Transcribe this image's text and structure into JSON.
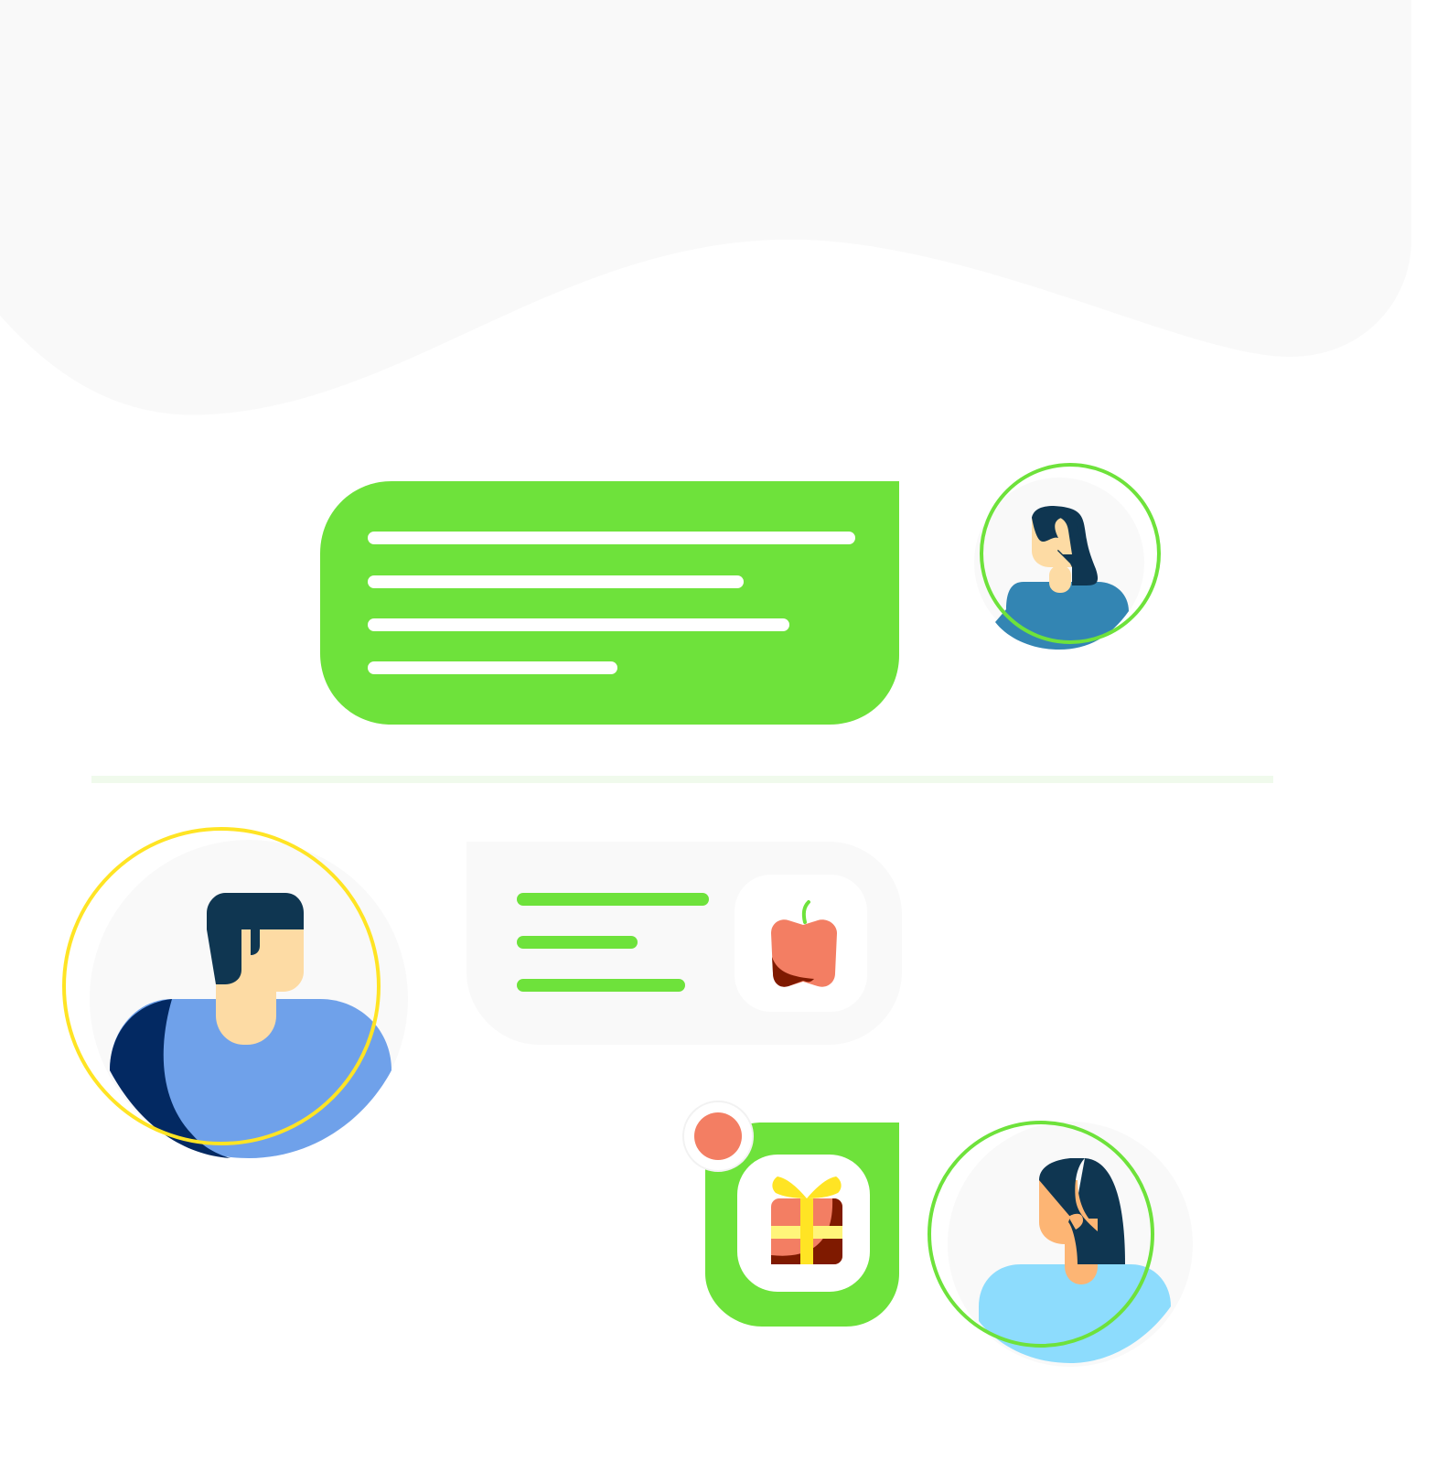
{
  "colors": {
    "background": "#ffffff",
    "wave": "#f9f9f9",
    "accent_green": "#6ee23b",
    "divider": "#f0faec",
    "light_card": "#f9f9f9",
    "white_line": "#ffffff",
    "ring_yellow": "#ffe424",
    "ring_green": "#6ee23b",
    "notification_dot": "#f37e63",
    "hair_dark": "#0f3651",
    "skin_light": "#fddba4",
    "skin_tan": "#fdb574",
    "shirt_blue": "#6fa1ea",
    "shirt_navy": "#032962",
    "shirt_steel": "#3385b3",
    "shirt_sky": "#8ddcfd",
    "apple_red": "#f37e63",
    "apple_dark": "#7f1a00",
    "gift_ribbon": "#ffe424",
    "gift_band": "#fff57a"
  },
  "icons": {
    "wave": "wave-background",
    "sent_message": "chat-bubble-sent",
    "received_message": "chat-bubble-received",
    "apple": "apple-icon",
    "gift": "gift-icon",
    "user_woman_top": "woman-avatar-icon",
    "user_man": "man-avatar-icon",
    "user_woman_bottom": "woman-avatar-icon",
    "notification": "notification-dot-icon"
  }
}
